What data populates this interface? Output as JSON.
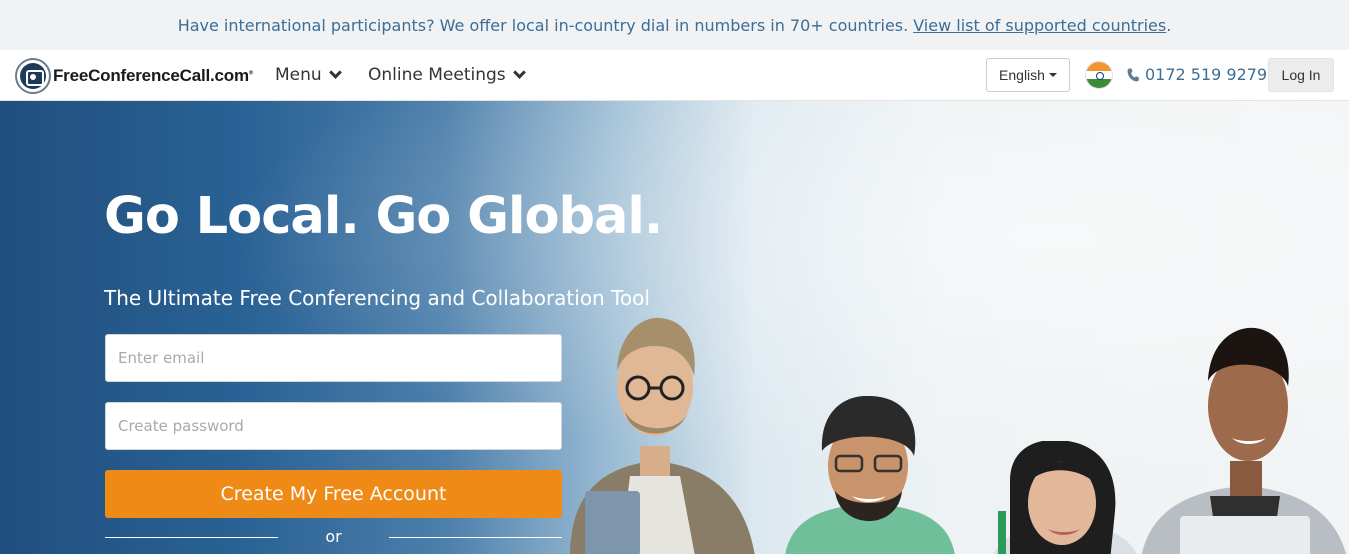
{
  "banner": {
    "text": "Have international participants? We offer local in-country dial in numbers in 70+ countries.",
    "link": "View list of supported countries",
    "trail": "."
  },
  "header": {
    "logo_text": "FreeConferenceCall.com",
    "logo_mark": "®",
    "nav": [
      {
        "label": "Menu",
        "icon": "chevron-down-icon"
      },
      {
        "label": "Online Meetings",
        "icon": "chevron-down-icon"
      }
    ],
    "language": "English",
    "flag": "india-flag",
    "phone": "0172 519 9279",
    "login": "Log In"
  },
  "hero": {
    "title": "Go Local. Go Global.",
    "subtitle": "The Ultimate Free Conferencing and Collaboration Tool",
    "email_placeholder": "Enter email",
    "password_placeholder": "Create password",
    "cta": "Create My Free Account",
    "or": "or"
  },
  "colors": {
    "accent": "#ef8a17",
    "link": "#3c6e96",
    "hero_dark": "#1f4f7e"
  }
}
